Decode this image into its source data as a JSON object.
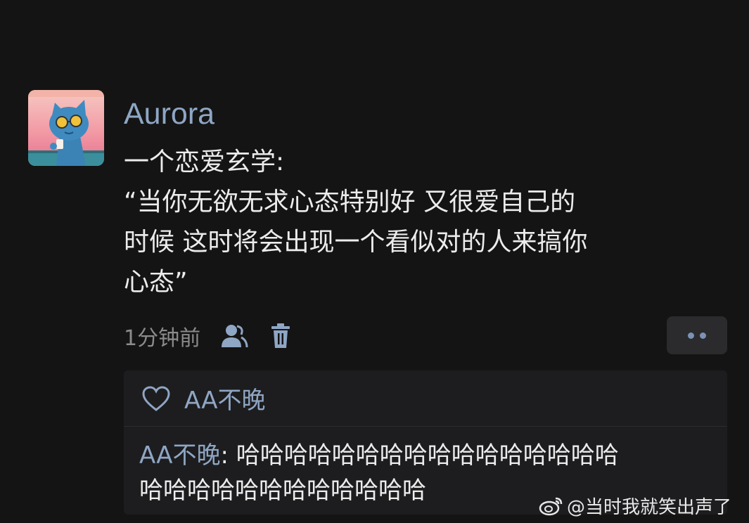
{
  "post": {
    "author": "Aurora",
    "content_lines": [
      "一个恋爱玄学:",
      "“当你无欲无求心态特别好 又很爱自己的",
      "时候 这时将会出现一个看似对的人来搞你",
      "心态”"
    ],
    "timestamp": "1分钟前",
    "icons": {
      "visibility": "person-icon",
      "delete": "trash-icon",
      "more": "more-dots-icon"
    }
  },
  "likes": {
    "icon": "heart-icon",
    "user": "AA不晚"
  },
  "reply": {
    "author": "AA不晚",
    "separator": ": ",
    "line1": "哈哈哈哈哈哈哈哈哈哈哈哈哈哈哈哈",
    "line2": "哈哈哈哈哈哈哈哈哈哈哈哈"
  },
  "watermark": {
    "text": "@当时我就笑出声了",
    "icon": "weibo-icon"
  },
  "colors": {
    "background": "#141414",
    "accent_blue": "#8fa6c4",
    "text": "#ececec",
    "muted": "#8b8b8b",
    "panel": "#1d1d1f"
  }
}
